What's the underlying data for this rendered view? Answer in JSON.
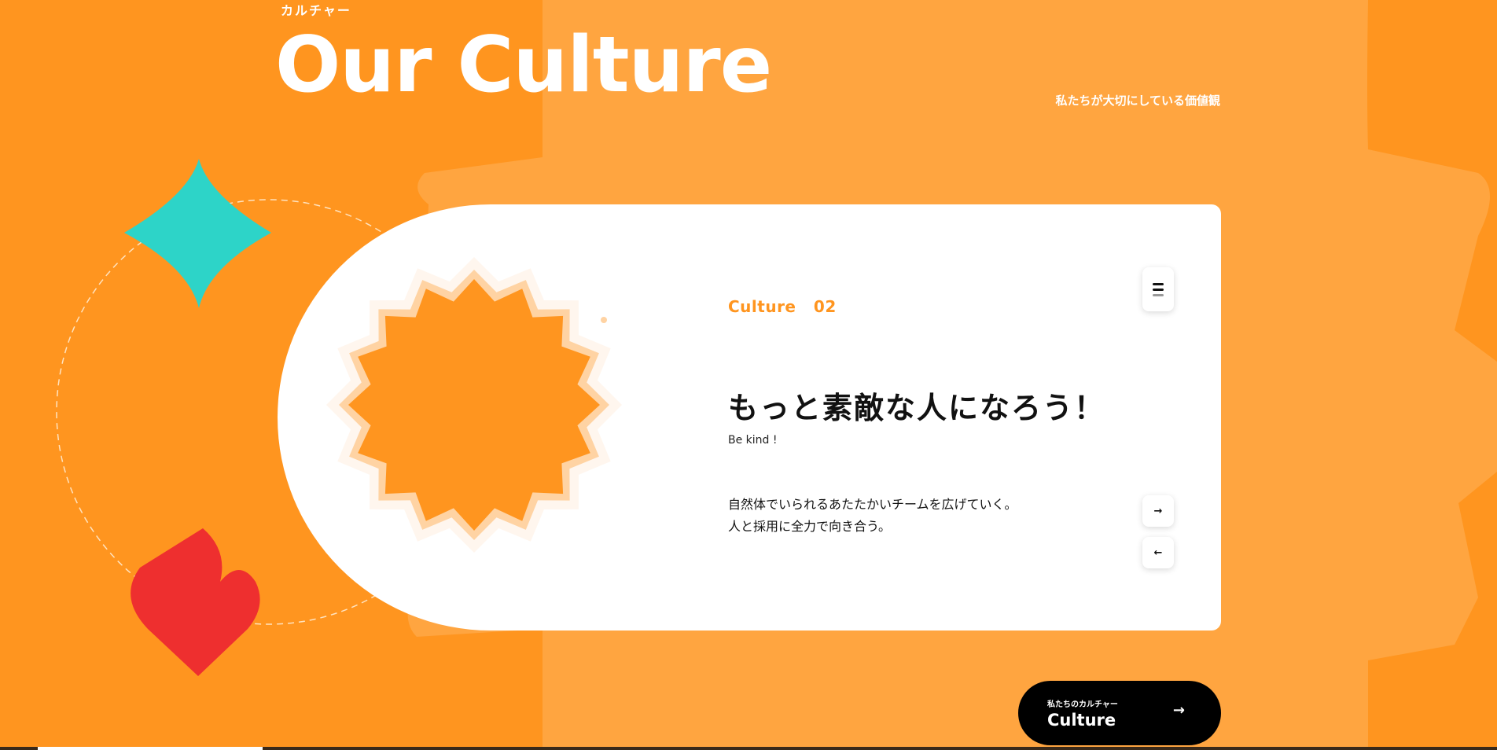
{
  "header": {
    "eyebrow": "カルチャー",
    "title": "Our Culture",
    "subtitle": "私たちが大切にしている価値観"
  },
  "card": {
    "label": "Culture",
    "index": "02",
    "heading": "もっと素敵な人になろう！",
    "english": "Be kind !",
    "body_lines": [
      "自然体でいられるあたたかいチームを広げていく。",
      "人と採用に全力で向き合う。"
    ]
  },
  "controls": {
    "next_icon": "→",
    "prev_icon": "←",
    "menu_icon": "menu-icon"
  },
  "cta": {
    "small_label": "私たちのカルチャー",
    "big_label": "Culture",
    "arrow": "→"
  },
  "colors": {
    "background": "#FF951F",
    "background_shape": "#FFA540",
    "accent": "#FF951F",
    "teal": "#2DD4C8",
    "red": "#EE2F2F",
    "card": "#FFFFFF",
    "cta": "#000000"
  }
}
